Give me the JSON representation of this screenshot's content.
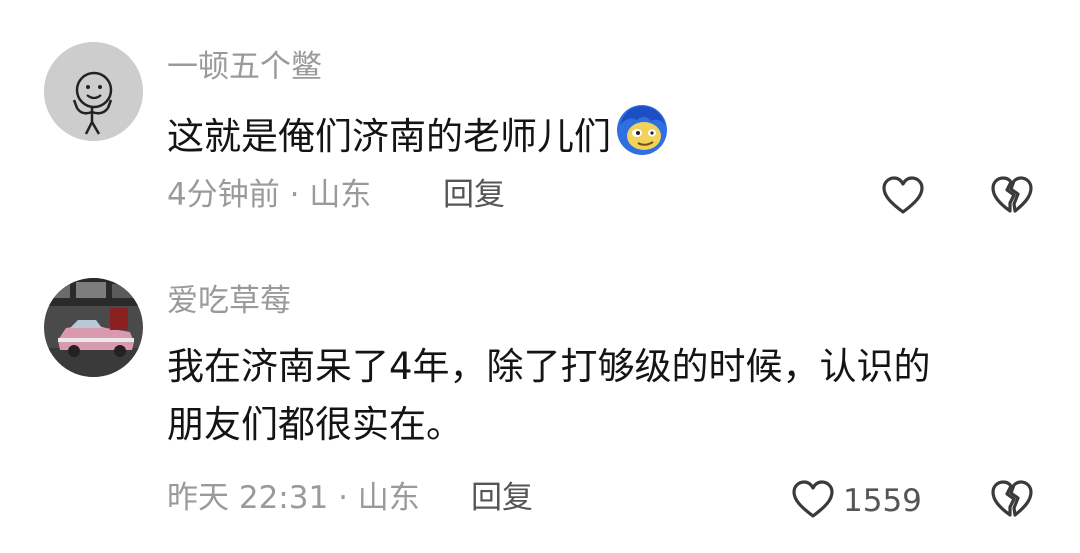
{
  "comments": [
    {
      "username": "一顿五个鳖",
      "text_lines": [
        "这就是俺们济南的老师儿们"
      ],
      "emoji": "blue-hair-face-emoji",
      "time": "4分钟前",
      "separator": "·",
      "location": "山东",
      "reply_label": "回复",
      "like_count": ""
    },
    {
      "username": "爱吃草莓",
      "text_lines": [
        "我在济南呆了4年，除了打够级的时候，认识的",
        "朋友们都很实在。"
      ],
      "time": "昨天 22:31",
      "separator": "·",
      "location": "山东",
      "reply_label": "回复",
      "like_count": "1559"
    }
  ],
  "icons": {
    "like": "heart-outline-icon",
    "dislike": "broken-heart-icon"
  },
  "colors": {
    "username": "#9a9a9a",
    "text": "#141414",
    "meta": "#9a9a9a",
    "action": "#555555"
  }
}
